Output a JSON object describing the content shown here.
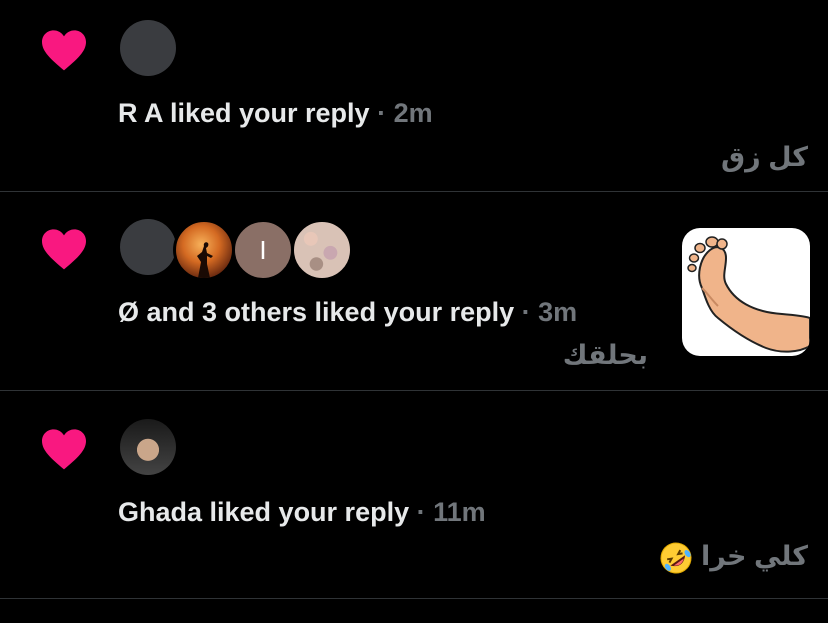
{
  "colors": {
    "background": "#000000",
    "heart": "#f91880",
    "text_primary": "#e7e9ea",
    "text_secondary": "#71767b",
    "divider": "#2f3336"
  },
  "notifications": [
    {
      "icon": "heart-icon",
      "actor_text": "R A liked your reply",
      "separator": "·",
      "time": "2m",
      "snippet": "كل زق"
    },
    {
      "icon": "heart-icon",
      "avatar_letter": "I",
      "actor_text": "Ø and 3 others liked your reply",
      "separator": "·",
      "time": "3m",
      "snippet": "بحلقك",
      "thumbnail": "foot-sticker-image"
    },
    {
      "icon": "heart-icon",
      "actor_text": "Ghada liked your reply",
      "separator": "·",
      "time": "11m",
      "snippet": "كلي خرا",
      "snippet_emoji": "rolling-on-floor-laughing-emoji"
    }
  ]
}
